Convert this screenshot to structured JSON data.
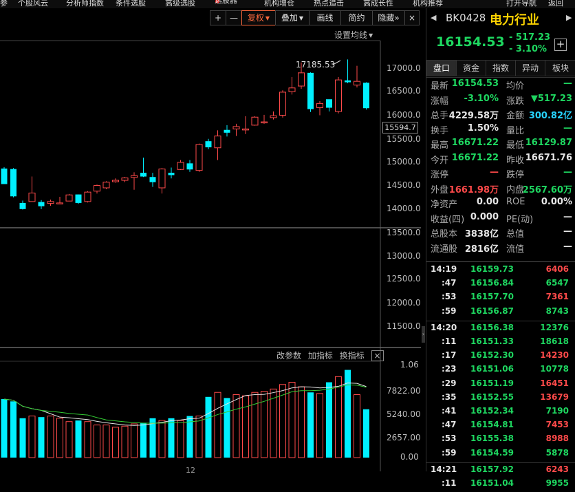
{
  "menu": [
    "参",
    "个股风云",
    "分析师指数",
    "条件选股",
    "高级选股",
    "选股器",
    "机构增仓",
    "热点追击",
    "高成长性",
    "机构推荐",
    "打开导航",
    "返回"
  ],
  "toolbar": {
    "plus": "+",
    "minus": "—",
    "fuquan": "复权",
    "overlay": "叠加",
    "draw_line": "画线",
    "simple": "简约",
    "hide": "隐藏",
    "hide_arrow": "»",
    "close": "×",
    "ma_settings": "设置均线"
  },
  "price_axis": {
    "labels": [
      "17000.0",
      "16500.0",
      "16000.0",
      "15500.0",
      "15000.0",
      "14500.0",
      "14000.0",
      "13500.0",
      "13000.0",
      "12500.0",
      "12000.0",
      "11500.0"
    ],
    "current_label": "15594.7",
    "high_marker": "17185.53",
    "ymin": 11000,
    "ymax": 17500
  },
  "chart_data": {
    "type": "candlestick",
    "candles": [
      [
        14870,
        14900,
        14700,
        14540
      ],
      [
        14860,
        14880,
        14260,
        14280
      ],
      [
        14140,
        14000,
        14190,
        14010
      ],
      [
        14170,
        14700,
        14250,
        14350
      ],
      [
        14160,
        14010,
        14200,
        14070
      ],
      [
        14130,
        14210,
        14080,
        14170
      ],
      [
        14140,
        14270,
        14130,
        14140
      ],
      [
        14180,
        14330,
        14180,
        14310
      ],
      [
        14320,
        14320,
        14120,
        14140
      ],
      [
        14170,
        14390,
        14150,
        14370
      ],
      [
        14390,
        14530,
        14340,
        14510
      ],
      [
        14460,
        14600,
        14430,
        14580
      ],
      [
        14590,
        14660,
        14570,
        14620
      ],
      [
        14620,
        14690,
        14580,
        14670
      ],
      [
        14680,
        14790,
        14420,
        14720
      ],
      [
        14780,
        15100,
        14690,
        14700
      ],
      [
        14690,
        14780,
        14480,
        14580
      ],
      [
        14460,
        14880,
        14340,
        14860
      ],
      [
        14780,
        14890,
        14660,
        14730
      ],
      [
        14850,
        15050,
        14840,
        15000
      ],
      [
        14980,
        15050,
        14800,
        14850
      ],
      [
        14830,
        15400,
        14800,
        15380
      ],
      [
        15450,
        15500,
        15280,
        15320
      ],
      [
        15310,
        15680,
        15050,
        15560
      ],
      [
        15690,
        15790,
        15550,
        15630
      ],
      [
        15710,
        15820,
        15560,
        15760
      ],
      [
        15700,
        15980,
        15600,
        15710
      ],
      [
        15790,
        15980,
        15780,
        15960
      ],
      [
        15860,
        16010,
        15820,
        15860
      ],
      [
        15950,
        16080,
        15910,
        15990
      ],
      [
        16000,
        16530,
        15950,
        16490
      ],
      [
        16500,
        16810,
        16440,
        16580
      ],
      [
        16620,
        17120,
        16560,
        16900
      ],
      [
        16900,
        16910,
        16070,
        16130
      ],
      [
        16160,
        16300,
        16000,
        16250
      ],
      [
        16340,
        16310,
        16080,
        16160
      ],
      [
        16080,
        16810,
        16040,
        16750
      ],
      [
        16740,
        17185,
        16680,
        16700
      ],
      [
        16640,
        17050,
        16590,
        16720
      ],
      [
        16690,
        16700,
        16120,
        16150
      ]
    ],
    "volumes": [
      5200,
      5000,
      3500,
      3700,
      3600,
      3700,
      3500,
      3200,
      3300,
      3200,
      2900,
      2900,
      2700,
      2800,
      3000,
      3100,
      3500,
      3300,
      3500,
      3300,
      3700,
      3700,
      5400,
      5800,
      5300,
      5600,
      5500,
      5800,
      5900,
      6100,
      6500,
      6700,
      6300,
      5800,
      5700,
      6700,
      7200,
      7800,
      5600,
      4300
    ],
    "vol_axis_labels": [
      "1.06",
      "7822.00",
      "5240.00",
      "2657.00",
      "0.00"
    ],
    "vol_max": 10600
  },
  "indicator_buttons": [
    "改参数",
    "加指标",
    "换指标"
  ],
  "indicator_close": "×",
  "x_label": "12",
  "panel": {
    "code": "BK0428",
    "name": "电力行业",
    "price": "16154.53",
    "change": "- 517.23",
    "change_pct": "- 3.10%",
    "plus_button": "+",
    "tabs": [
      "盘口",
      "资金",
      "指数",
      "异动",
      "板块"
    ],
    "stats": [
      [
        "最新",
        "16154.53",
        "green",
        "均价",
        "—",
        "green"
      ],
      [
        "涨幅",
        "-3.10%",
        "green",
        "涨跌",
        "▼517.23",
        "green"
      ],
      [
        "总手",
        "4229.58万",
        "white",
        "金额",
        "300.82亿",
        "cyan"
      ],
      [
        "换手",
        "1.50%",
        "white",
        "量比",
        "—",
        "green"
      ],
      [
        "最高",
        "16671.22",
        "green",
        "最低",
        "16129.87",
        "green"
      ],
      [
        "今开",
        "16671.22",
        "green",
        "昨收",
        "16671.76",
        "white"
      ],
      [
        "涨停",
        "—",
        "red",
        "跌停",
        "—",
        "green"
      ],
      [
        "外盘",
        "1661.98万",
        "red",
        "内盘",
        "2567.60万",
        "green"
      ],
      [
        "净资产",
        "0.00",
        "white",
        "ROE",
        "0.00%",
        "white"
      ],
      [
        "收益(四)",
        "0.000",
        "white",
        "PE(动)",
        "—",
        "white"
      ],
      [
        "总股本",
        "3838亿",
        "white",
        "总值",
        "—",
        "white"
      ],
      [
        "流通股",
        "2816亿",
        "white",
        "流值",
        "—",
        "white"
      ]
    ],
    "ticks": [
      [
        "14:19",
        "16159.73",
        "6406",
        "red"
      ],
      [
        ":47",
        "16156.84",
        "6547",
        "green"
      ],
      [
        ":53",
        "16157.70",
        "7361",
        "red"
      ],
      [
        ":59",
        "16156.87",
        "8743",
        "green"
      ],
      [
        "14:20",
        "16156.38",
        "12376",
        "green"
      ],
      [
        ":11",
        "16151.33",
        "18618",
        "green"
      ],
      [
        ":17",
        "16152.30",
        "14230",
        "red"
      ],
      [
        ":23",
        "16151.06",
        "10778",
        "green"
      ],
      [
        ":29",
        "16151.19",
        "16451",
        "red"
      ],
      [
        ":35",
        "16152.55",
        "13679",
        "red"
      ],
      [
        ":41",
        "16152.34",
        "7190",
        "green"
      ],
      [
        ":47",
        "16154.81",
        "7453",
        "red"
      ],
      [
        ":53",
        "16155.38",
        "8988",
        "red"
      ],
      [
        ":59",
        "16154.59",
        "5878",
        "green"
      ],
      [
        "14:21",
        "16157.92",
        "6243",
        "red"
      ],
      [
        ":11",
        "16151.04",
        "9955",
        "green"
      ]
    ]
  },
  "colors": {
    "up": "#ff4a4a",
    "down": "#00f0ff",
    "ma1": "#e6e6e6",
    "ma2": "#ffd400",
    "ma3": "#33cc33"
  }
}
